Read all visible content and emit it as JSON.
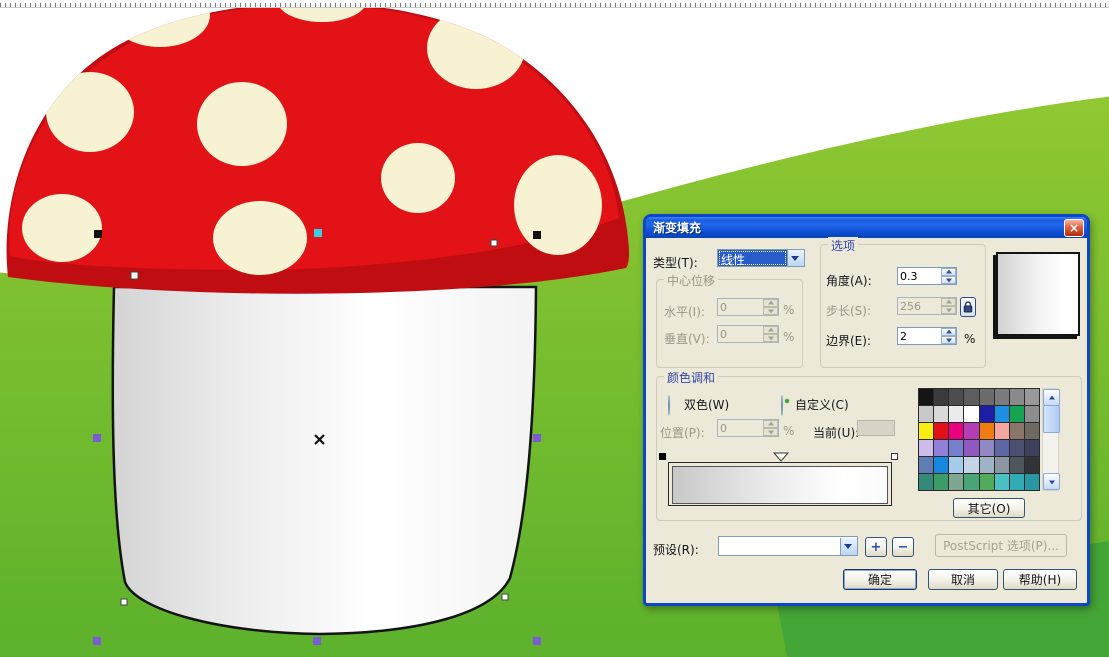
{
  "window": {
    "title": "渐变填充"
  },
  "icons": {
    "close": "×"
  },
  "dialog": {
    "type": {
      "label": "类型(T):",
      "value": "线性"
    },
    "center_offset": {
      "title": "中心位移",
      "horizontal": {
        "label": "水平(I):",
        "value": "0",
        "unit": "%"
      },
      "vertical": {
        "label": "垂直(V):",
        "value": "0",
        "unit": "%"
      }
    },
    "options": {
      "title": "选项",
      "angle": {
        "label": "角度(A):",
        "value": "0.3"
      },
      "steps": {
        "label": "步长(S):",
        "value": "256"
      },
      "edge": {
        "label": "边界(E):",
        "value": "2",
        "unit": "%"
      }
    },
    "color_blend": {
      "title": "颜色调和",
      "two_color_label": "双色(W)",
      "custom_label": "自定义(C)",
      "position": {
        "label": "位置(P):",
        "value": "0",
        "unit": "%"
      },
      "current_label": "当前(U):",
      "others_button": "其它(O)"
    },
    "presets": {
      "label": "预设(R):",
      "value": "",
      "add": "+",
      "remove": "−"
    },
    "postscript_button": "PostScript 选项(P)...",
    "buttons": {
      "ok": "确定",
      "cancel": "取消",
      "help": "帮助(H)"
    }
  },
  "palette": {
    "colors": [
      "#151515",
      "#3b3b3b",
      "#4d4d4d",
      "#5d5d5d",
      "#6c6c6c",
      "#7b7b7b",
      "#8a8a8a",
      "#999999",
      "#c9c9c9",
      "#d9d9d9",
      "#ececec",
      "#ffffff",
      "#1d1da6",
      "#1e8fe0",
      "#17a354",
      "#8d8d8d",
      "#f8ee12",
      "#e01118",
      "#e8007e",
      "#b43cb4",
      "#ef7d12",
      "#f4a6a0",
      "#8a7668",
      "#6e6a62",
      "#cbbcec",
      "#9180d8",
      "#7680cc",
      "#9059c0",
      "#9189c4",
      "#5f68a5",
      "#4b4f72",
      "#3e415c",
      "#5e7db4",
      "#1787e0",
      "#a6cbec",
      "#c2d4e6",
      "#9fb3c6",
      "#8c96a2",
      "#4e565e",
      "#303438",
      "#35897a",
      "#3c9c68",
      "#7fa690",
      "#49a478",
      "#52aa5c",
      "#49c0c2",
      "#32acb4",
      "#2898a4"
    ]
  },
  "colors": {
    "dialog_bg": "#ece9d8",
    "title_bar_blue": "#1a5ad8",
    "selection_blue": "#2a5cc8",
    "cap_red": "#e21217",
    "cap_shadow_red": "#bf0d12",
    "spot_cream": "#f7f2d1",
    "grass_light": "#8cc42e",
    "grass_dark": "#44a637",
    "handle_purple": "#7b5cd6",
    "handle_cyan": "#3ecfe8"
  }
}
